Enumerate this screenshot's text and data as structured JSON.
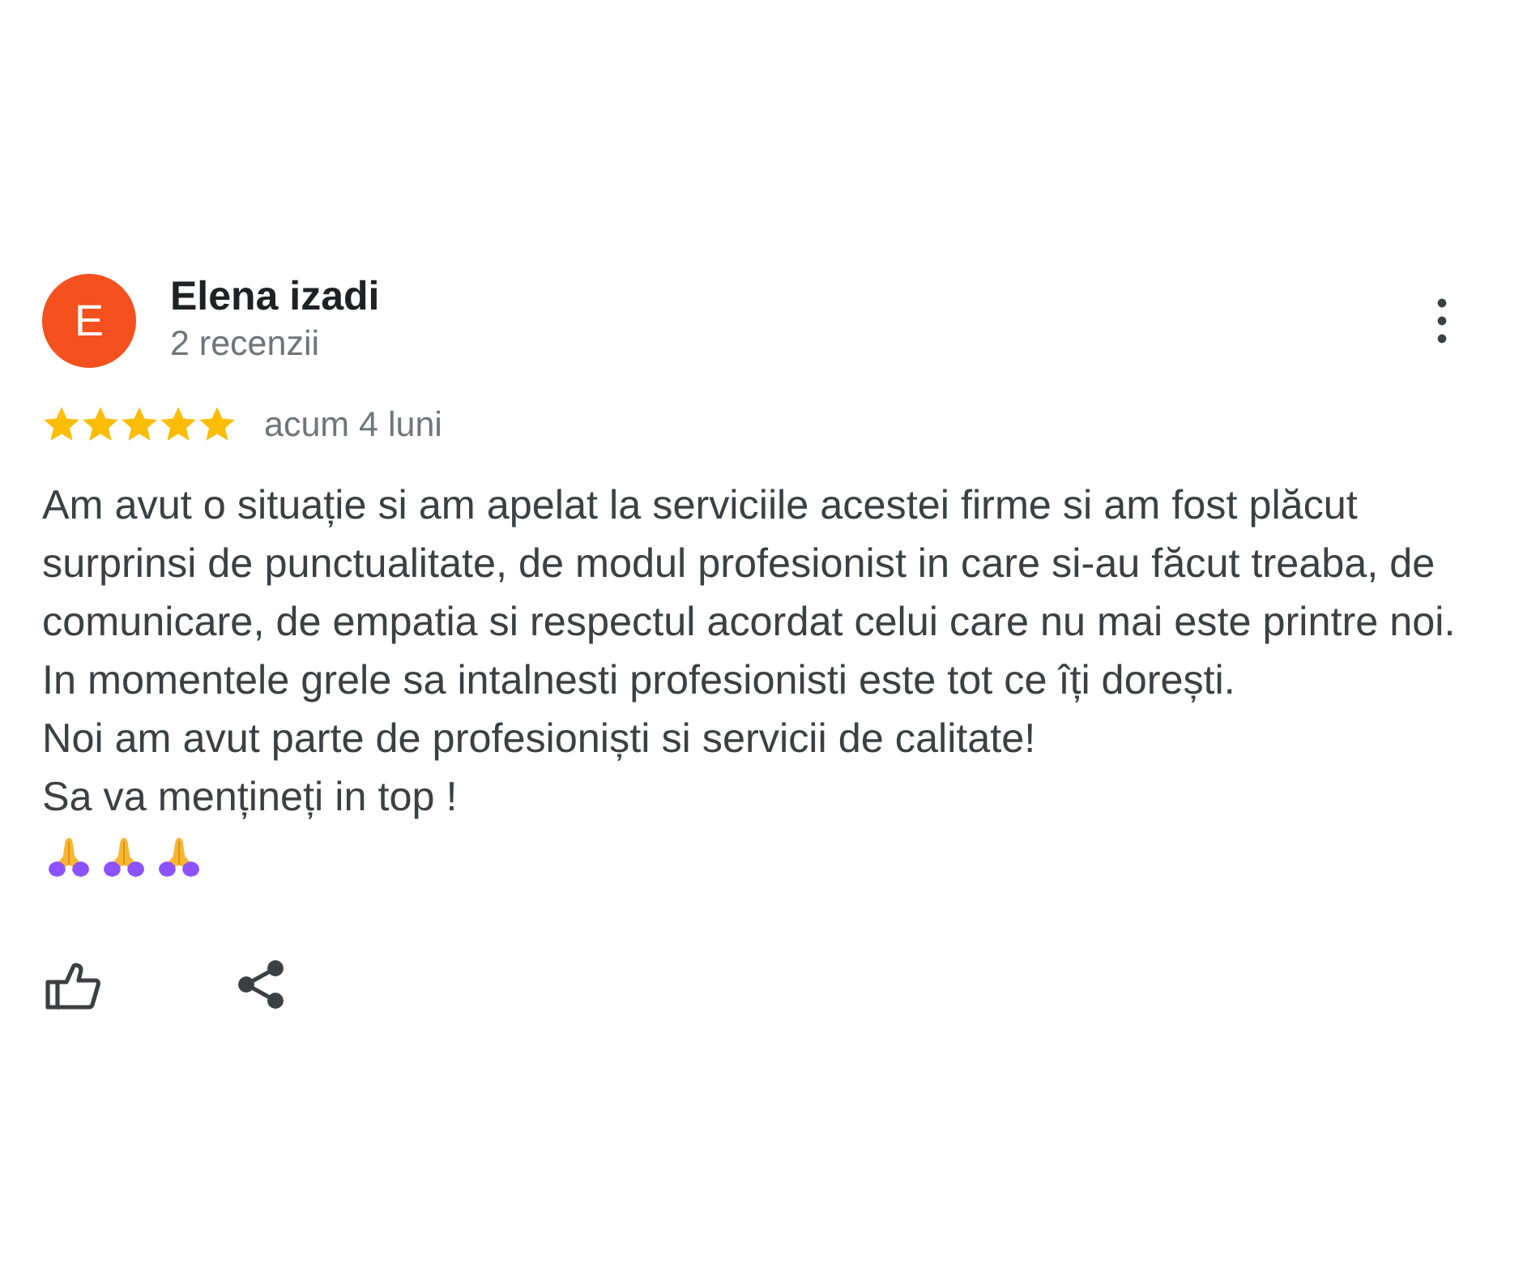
{
  "review": {
    "author": {
      "avatar_letter": "E",
      "name": "Elena izadi",
      "review_count": "2 recenzii"
    },
    "stars": 5,
    "time": "acum 4 luni",
    "text": "Am avut o situație si am apelat la serviciile acestei firme si am fost plăcut surprinsi de punctualitate, de modul profesionist in care si-au făcut treaba, de comunicare, de empatia si respectul acordat celui care nu mai este printre noi.\nIn momentele grele sa intalnesti profesionisti este tot ce îți dorești.\nNoi am avut parte de profesioniști si servicii de calitate!\nSa va mențineți in top !"
  }
}
